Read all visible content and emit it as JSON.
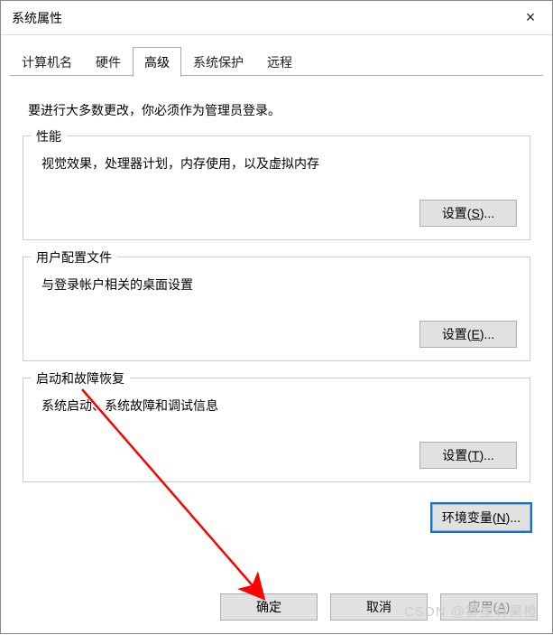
{
  "title": "系统属性",
  "closeIcon": "×",
  "tabs": [
    {
      "label": "计算机名"
    },
    {
      "label": "硬件"
    },
    {
      "label": "高级",
      "active": true
    },
    {
      "label": "系统保护"
    },
    {
      "label": "远程"
    }
  ],
  "notice": "要进行大多数更改，你必须作为管理员登录。",
  "groups": {
    "performance": {
      "title": "性能",
      "desc": "视觉效果，处理器计划，内存使用，以及虚拟内存",
      "settingsPrefix": "设置(",
      "settingsKey": "S",
      "settingsSuffix": ")..."
    },
    "userProfile": {
      "title": "用户配置文件",
      "desc": "与登录帐户相关的桌面设置",
      "settingsPrefix": "设置(",
      "settingsKey": "E",
      "settingsSuffix": ")..."
    },
    "startup": {
      "title": "启动和故障恢复",
      "desc": "系统启动、系统故障和调试信息",
      "settingsPrefix": "设置(",
      "settingsKey": "T",
      "settingsSuffix": ")..."
    }
  },
  "envVarsPrefix": "环境变量(",
  "envVarsKey": "N",
  "envVarsSuffix": ")...",
  "footer": {
    "ok": "确定",
    "cancel": "取消",
    "applyPrefix": "应用(",
    "applyKey": "A",
    "applySuffix": ")"
  },
  "watermark": "CSDN @雾里有果橙"
}
